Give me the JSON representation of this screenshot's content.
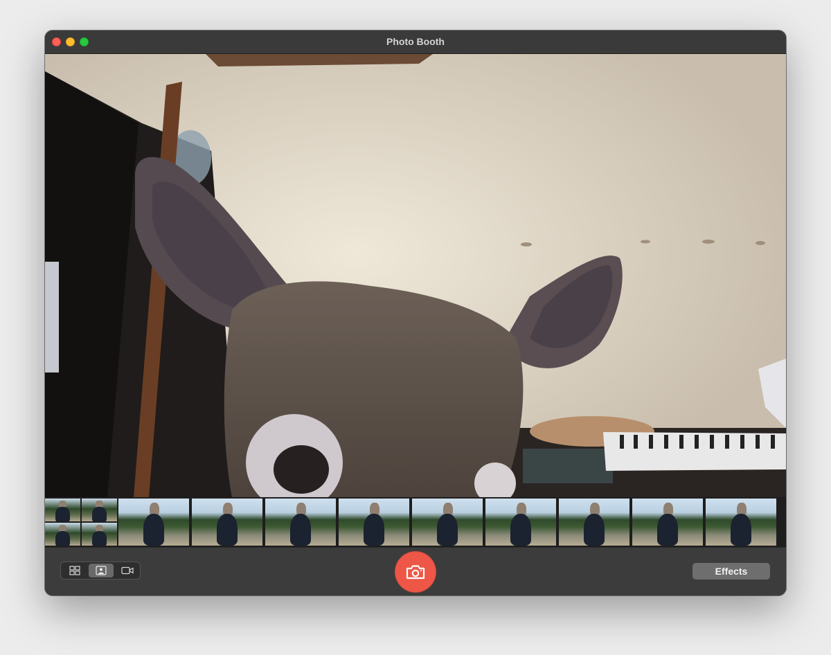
{
  "window": {
    "title": "Photo Booth"
  },
  "toolbar": {
    "modes": [
      {
        "icon": "grid-four-icon",
        "active": false
      },
      {
        "icon": "single-photo-icon",
        "active": true
      },
      {
        "icon": "video-camera-icon",
        "active": false
      }
    ],
    "shutter_icon": "camera-icon",
    "effects_label": "Effects",
    "accent_color": "#ee5747"
  },
  "filmstrip": {
    "count": 11
  }
}
